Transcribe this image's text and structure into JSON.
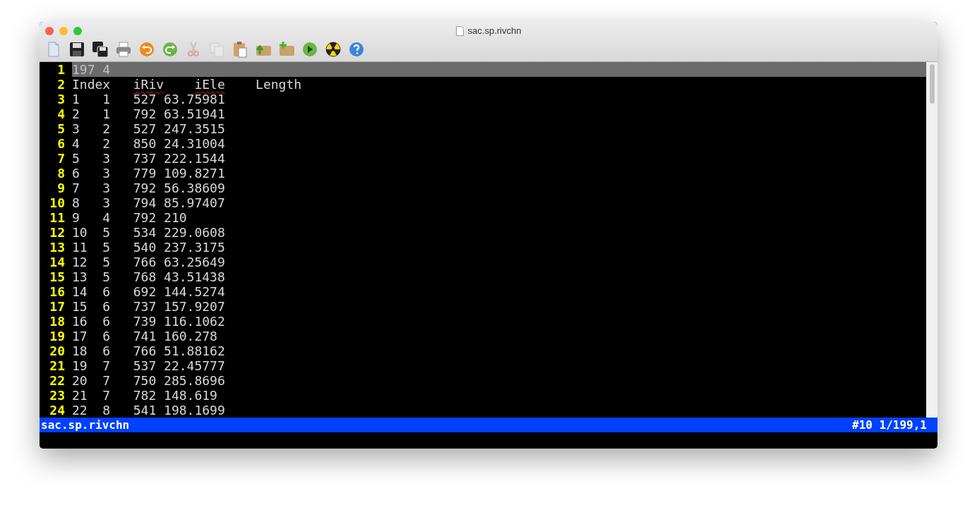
{
  "window": {
    "title": "sac.sp.rivchn"
  },
  "toolbar": [
    {
      "kind": "new",
      "disabled": false
    },
    {
      "kind": "save",
      "disabled": false
    },
    {
      "kind": "save-all",
      "disabled": false
    },
    {
      "kind": "print",
      "disabled": false
    },
    {
      "kind": "undo",
      "disabled": false
    },
    {
      "kind": "redo",
      "disabled": false
    },
    {
      "kind": "cut",
      "disabled": true
    },
    {
      "kind": "copy",
      "disabled": true
    },
    {
      "kind": "paste",
      "disabled": false
    },
    {
      "kind": "load",
      "disabled": false
    },
    {
      "kind": "add",
      "disabled": false
    },
    {
      "kind": "run",
      "disabled": false
    },
    {
      "kind": "hazard",
      "disabled": false
    },
    {
      "kind": "help",
      "disabled": false
    }
  ],
  "editor": {
    "lines": [
      {
        "number": "1",
        "current": true,
        "text": "197 4"
      },
      {
        "number": "2",
        "current": false,
        "segments": [
          {
            "text": "Index",
            "misspelled": false
          },
          {
            "text": "iRiv",
            "misspelled": true
          },
          {
            "text": "iEle",
            "misspelled": true
          },
          {
            "text": "Length",
            "misspelled": false
          }
        ]
      },
      {
        "number": "3",
        "current": false,
        "text": "1\t1\t527 63.75981"
      },
      {
        "number": "4",
        "current": false,
        "text": "2\t1\t792 63.51941"
      },
      {
        "number": "5",
        "current": false,
        "text": "3\t2\t527 247.3515"
      },
      {
        "number": "6",
        "current": false,
        "text": "4\t2\t850 24.31004"
      },
      {
        "number": "7",
        "current": false,
        "text": "5\t3\t737 222.1544"
      },
      {
        "number": "8",
        "current": false,
        "text": "6\t3\t779 109.8271"
      },
      {
        "number": "9",
        "current": false,
        "text": "7\t3\t792 56.38609"
      },
      {
        "number": "10",
        "current": false,
        "text": "8\t3\t794 85.97407"
      },
      {
        "number": "11",
        "current": false,
        "text": "9\t4\t792 210"
      },
      {
        "number": "12",
        "current": false,
        "text": "10\t5\t534 229.0608"
      },
      {
        "number": "13",
        "current": false,
        "text": "11\t5\t540 237.3175"
      },
      {
        "number": "14",
        "current": false,
        "text": "12\t5\t766 63.25649"
      },
      {
        "number": "15",
        "current": false,
        "text": "13\t5\t768 43.51438"
      },
      {
        "number": "16",
        "current": false,
        "text": "14\t6\t692 144.5274"
      },
      {
        "number": "17",
        "current": false,
        "text": "15\t6\t737 157.9207"
      },
      {
        "number": "18",
        "current": false,
        "text": "16\t6\t739 116.1062"
      },
      {
        "number": "19",
        "current": false,
        "text": "17\t6\t741 160.278"
      },
      {
        "number": "20",
        "current": false,
        "text": "18\t6\t766 51.88162"
      },
      {
        "number": "21",
        "current": false,
        "text": "19\t7\t537 22.45777"
      },
      {
        "number": "22",
        "current": false,
        "text": "20\t7\t750 285.8696"
      },
      {
        "number": "23",
        "current": false,
        "text": "21\t7\t782 148.619"
      },
      {
        "number": "24",
        "current": false,
        "text": "22\t8\t541 198.1699"
      }
    ]
  },
  "status_bar": {
    "filename": "sac.sp.rivchn",
    "position": "#10 1/199,1"
  }
}
